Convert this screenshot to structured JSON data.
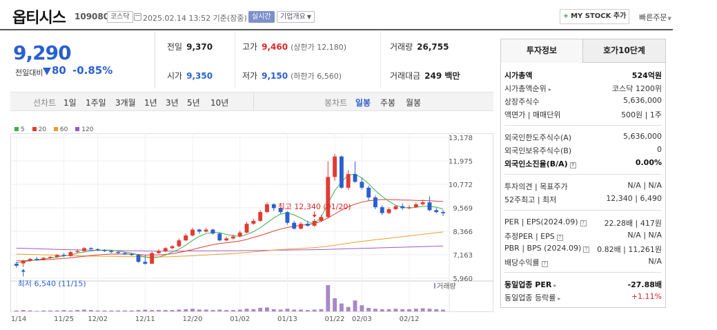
{
  "header": {
    "stock_name": "옵티시스",
    "stock_code": "109080",
    "market_tag": "코스닥",
    "datetime": "2025.02.14 13:52  기준(장중)",
    "live_tag": "실시간",
    "company_info": "기업개요",
    "mystock_label": "MY STOCK 추가",
    "quick_order": "빠른주문"
  },
  "price": {
    "current": "9,290",
    "change_label": "전일대비",
    "change": "80",
    "change_pct": "-0.85%"
  },
  "quotes": {
    "prev_close_label": "전일",
    "prev_close": "9,370",
    "open_label": "시가",
    "open": "9,350",
    "high_label": "고가",
    "high": "9,460",
    "upper_limit": "(상한가 12,180)",
    "low_label": "저가",
    "low": "9,150",
    "lower_limit": "(하한가 6,560)",
    "volume_label": "거래량",
    "volume": "26,755",
    "amount_label": "거래대금",
    "amount": "249 백만"
  },
  "period_bar": {
    "line_chart_label": "선차트",
    "periods": [
      "1일",
      "1주일",
      "3개월",
      "1년",
      "3년",
      "5년",
      "10년"
    ],
    "candle_chart_label": "봉차트",
    "candle_periods": [
      "일봉",
      "주봉",
      "월봉"
    ],
    "active_candle": "일봉"
  },
  "chart_data": {
    "type": "candlestick",
    "legend": [
      {
        "name": "5",
        "color": "#3cb043"
      },
      {
        "name": "20",
        "color": "#e03c31"
      },
      {
        "name": "60",
        "color": "#f29a2e"
      },
      {
        "name": "120",
        "color": "#9b59c6"
      }
    ],
    "y_ticks": [
      "13,178",
      "11,975",
      "10,772",
      "9,569",
      "8,366",
      "7,163",
      "5,960"
    ],
    "ylim": [
      5960,
      13178
    ],
    "x_ticks": [
      {
        "label": "11/14",
        "i": 0
      },
      {
        "label": "11/25",
        "i": 7
      },
      {
        "label": "12/02",
        "i": 12
      },
      {
        "label": "12/11",
        "i": 19
      },
      {
        "label": "12/20",
        "i": 26
      },
      {
        "label": "01/02",
        "i": 33
      },
      {
        "label": "01/13",
        "i": 40
      },
      {
        "label": "01/22",
        "i": 47
      },
      {
        "label": "02/03",
        "i": 51
      },
      {
        "label": "02/12",
        "i": 58
      }
    ],
    "n": 61,
    "high_annotation": "최고 12,340 (01/20)",
    "high_index": 44,
    "low_annotation": "최저 6,540 (11/15)",
    "low_index": 1,
    "volume_label": "거래량",
    "candles": [
      [
        6700,
        6600,
        6800,
        6500
      ],
      [
        6720,
        6850,
        6900,
        6540
      ],
      [
        6850,
        6950,
        7000,
        6800
      ],
      [
        6950,
        6900,
        7050,
        6850
      ],
      [
        6900,
        7000,
        7050,
        6880
      ],
      [
        7000,
        7050,
        7100,
        6950
      ],
      [
        7050,
        7150,
        7200,
        7000
      ],
      [
        7150,
        7100,
        7250,
        7050
      ],
      [
        7100,
        7300,
        7350,
        7050
      ],
      [
        7300,
        7350,
        7450,
        7250
      ],
      [
        7350,
        7500,
        7550,
        7300
      ],
      [
        7500,
        7450,
        7550,
        7400
      ],
      [
        7450,
        7400,
        7500,
        7350
      ],
      [
        7400,
        7350,
        7450,
        7300
      ],
      [
        7350,
        7300,
        7400,
        7250
      ],
      [
        7300,
        7250,
        7350,
        7200
      ],
      [
        7250,
        7200,
        7300,
        7150
      ],
      [
        7200,
        7150,
        7250,
        7100
      ],
      [
        7150,
        6800,
        7200,
        6750
      ],
      [
        6800,
        6700,
        7150,
        6650
      ],
      [
        6700,
        7250,
        7300,
        6700
      ],
      [
        7250,
        7350,
        7450,
        7200
      ],
      [
        7350,
        7500,
        7550,
        7300
      ],
      [
        7500,
        7600,
        7650,
        7450
      ],
      [
        7600,
        7900,
        8000,
        7550
      ],
      [
        7900,
        8150,
        8250,
        7850
      ],
      [
        8150,
        8450,
        8550,
        8100
      ],
      [
        8450,
        8350,
        8500,
        8250
      ],
      [
        8350,
        8450,
        8550,
        8300
      ],
      [
        8450,
        8250,
        8500,
        8200
      ],
      [
        8250,
        7900,
        8300,
        7850
      ],
      [
        7900,
        8000,
        8100,
        7850
      ],
      [
        8000,
        8100,
        8200,
        7950
      ],
      [
        8100,
        8300,
        8400,
        8050
      ],
      [
        8300,
        8750,
        8850,
        8250
      ],
      [
        8750,
        8900,
        9000,
        8700
      ],
      [
        8900,
        9350,
        9450,
        8850
      ],
      [
        9350,
        9750,
        9850,
        9300
      ],
      [
        9750,
        9550,
        9800,
        9400
      ],
      [
        9550,
        9350,
        9600,
        9250
      ],
      [
        9350,
        8800,
        9400,
        8700
      ],
      [
        8800,
        8500,
        8900,
        8450
      ],
      [
        8500,
        8750,
        8850,
        8450
      ],
      [
        8750,
        8650,
        8900,
        8600
      ],
      [
        8650,
        8900,
        9000,
        8600
      ],
      [
        8900,
        9100,
        9200,
        8850
      ],
      [
        9100,
        11150,
        11950,
        9050
      ],
      [
        11150,
        12200,
        12340,
        10950
      ],
      [
        12200,
        10600,
        12250,
        10550
      ],
      [
        10600,
        11300,
        11500,
        10500
      ],
      [
        11300,
        10900,
        11950,
        10850
      ],
      [
        10900,
        10600,
        11100,
        10500
      ],
      [
        10600,
        10100,
        10700,
        9950
      ],
      [
        10100,
        9600,
        10200,
        9500
      ],
      [
        9600,
        9300,
        9700,
        9200
      ],
      [
        9300,
        9500,
        9600,
        9250
      ],
      [
        9500,
        9650,
        9700,
        9450
      ],
      [
        9650,
        9550,
        9800,
        9450
      ],
      [
        9550,
        9600,
        9700,
        9500
      ],
      [
        9600,
        9750,
        9850,
        9550
      ],
      [
        9750,
        9850,
        10000,
        9700
      ],
      [
        9850,
        9450,
        10150,
        9400
      ],
      [
        9450,
        9350,
        9550,
        9300
      ],
      [
        9350,
        9290,
        9460,
        9150
      ]
    ],
    "ma5": [
      6750,
      6800,
      6850,
      6900,
      6950,
      7000,
      7050,
      7100,
      7150,
      7250,
      7300,
      7350,
      7400,
      7400,
      7400,
      7350,
      7300,
      7250,
      7150,
      7050,
      7000,
      7050,
      7150,
      7300,
      7450,
      7650,
      7900,
      8100,
      8250,
      8300,
      8300,
      8200,
      8150,
      8100,
      8200,
      8350,
      8550,
      8800,
      9050,
      9250,
      9300,
      9200,
      9050,
      8850,
      8750,
      9100,
      9800,
      10450,
      10900,
      11250,
      11300,
      11100,
      10800,
      10450,
      10150,
      9900,
      9700,
      9600,
      9550,
      9600,
      9650,
      9650,
      9600,
      9500
    ],
    "ma20": [
      6850,
      6850,
      6870,
      6890,
      6900,
      6920,
      6950,
      6980,
      7000,
      7050,
      7080,
      7120,
      7150,
      7180,
      7200,
      7200,
      7200,
      7200,
      7180,
      7150,
      7150,
      7160,
      7180,
      7220,
      7280,
      7350,
      7430,
      7520,
      7600,
      7680,
      7740,
      7780,
      7820,
      7870,
      7950,
      8050,
      8150,
      8260,
      8380,
      8480,
      8560,
      8620,
      8670,
      8710,
      8760,
      8880,
      9050,
      9250,
      9450,
      9620,
      9760,
      9860,
      9930,
      9970,
      9990,
      9990,
      9980,
      9970,
      9960,
      9950,
      9940,
      9930,
      9910,
      9890
    ],
    "ma60": [
      7200,
      7190,
      7180,
      7170,
      7160,
      7150,
      7140,
      7130,
      7120,
      7110,
      7100,
      7095,
      7090,
      7085,
      7080,
      7075,
      7070,
      7065,
      7060,
      7055,
      7050,
      7055,
      7060,
      7070,
      7080,
      7095,
      7110,
      7130,
      7150,
      7170,
      7190,
      7210,
      7230,
      7250,
      7280,
      7310,
      7340,
      7370,
      7400,
      7430,
      7450,
      7470,
      7490,
      7510,
      7530,
      7560,
      7600,
      7650,
      7700,
      7750,
      7800,
      7850,
      7890,
      7930,
      7970,
      8010,
      8050,
      8090,
      8130,
      8170,
      8210,
      8250,
      8290,
      8330
    ],
    "ma120": [
      7500,
      7490,
      7480,
      7470,
      7460,
      7450,
      7440,
      7430,
      7420,
      7410,
      7400,
      7395,
      7390,
      7385,
      7380,
      7375,
      7370,
      7365,
      7360,
      7355,
      7350,
      7350,
      7350,
      7350,
      7352,
      7354,
      7356,
      7358,
      7360,
      7362,
      7364,
      7366,
      7368,
      7370,
      7375,
      7380,
      7385,
      7390,
      7395,
      7400,
      7405,
      7410,
      7415,
      7420,
      7425,
      7430,
      7440,
      7450,
      7460,
      7470,
      7480,
      7490,
      7500,
      7510,
      7520,
      7530,
      7540,
      7550,
      7560,
      7570,
      7580,
      7590,
      7600,
      7610
    ],
    "volume": [
      2,
      3,
      2,
      1,
      2,
      2,
      2,
      3,
      2,
      3,
      4,
      3,
      2,
      2,
      2,
      2,
      2,
      2,
      3,
      4,
      3,
      3,
      3,
      3,
      4,
      5,
      6,
      4,
      4,
      3,
      4,
      3,
      3,
      4,
      6,
      5,
      8,
      9,
      5,
      4,
      6,
      4,
      4,
      3,
      4,
      5,
      60,
      30,
      18,
      10,
      25,
      14,
      8,
      6,
      5,
      5,
      6,
      5,
      5,
      6,
      7,
      6,
      5,
      4
    ]
  },
  "right_panel": {
    "tab_invest": "투자정보",
    "tab_orderbook": "호가10단계",
    "market_cap_label": "시가총액",
    "market_cap": "524억원",
    "market_cap_rank_label": "시가총액순위",
    "market_cap_rank": "코스닥 1200위",
    "listed_shares_label": "상장주식수",
    "listed_shares": "5,636,000",
    "par_label": "액면가 | 매매단위",
    "par": "500원 | 1주",
    "foreign_limit_label": "외국인한도주식수(A)",
    "foreign_limit": "5,636,000",
    "foreign_hold_label": "외국인보유주식수(B)",
    "foreign_hold": "0",
    "foreign_ratio_label": "외국인소진율(B/A)",
    "foreign_ratio": "0.00%",
    "opinion_label": "투자의견 | 목표주가",
    "opinion": "N/A | N/A",
    "range52_label": "52주최고 | 최저",
    "range52": "12,340 | 6,490",
    "per_label": "PER | EPS(2024.09)",
    "per": "22.28배 | 417원",
    "est_per_label": "추정PER | EPS",
    "est_per": "N/A | N/A",
    "pbr_label": "PBR | BPS (2024.09)",
    "pbr": "0.82배 | 11,261원",
    "dividend_label": "배당수익률",
    "dividend": "N/A",
    "sector_per_label": "동일업종 PER",
    "sector_per": "-27.88배",
    "sector_change_label": "동일업종 등락률",
    "sector_change": "+1.11%"
  }
}
